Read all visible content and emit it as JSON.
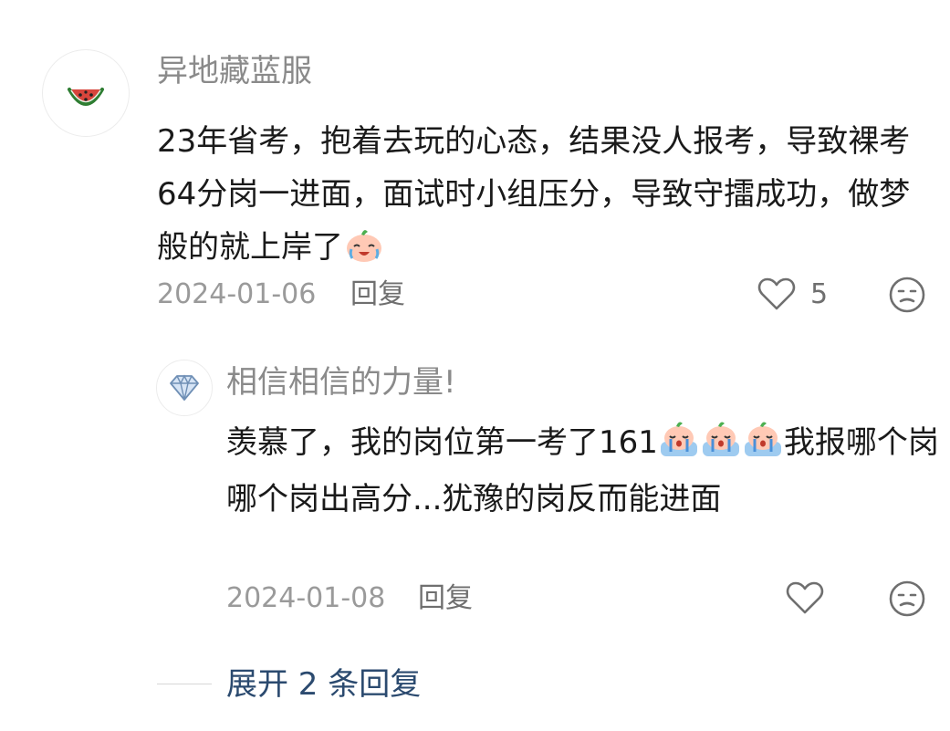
{
  "comment": {
    "username": "异地藏蓝服",
    "avatar_icon": "watermelon-icon",
    "text": "23年省考，抱着去玩的心态，结果没人报考，导致裸考64分岗一进面，面试时小组压分，导致守擂成功，做梦般的就上岸了",
    "emoji": "crying-laughing-peach-emoji",
    "date": "2024-01-06",
    "reply_label": "回复",
    "like_count": "5",
    "like_icon": "heart-outline-icon",
    "dislike_icon": "meh-face-icon"
  },
  "reply": {
    "username": "相信相信的力量!",
    "avatar_icon": "diamond-icon",
    "text_part1": "羡慕了，我的岗位第一考了161",
    "emojis": [
      "crying-peach-emoji",
      "crying-peach-emoji",
      "crying-peach-emoji"
    ],
    "text_part2": "我报哪个岗哪个岗出高分...犹豫的岗反而能进面",
    "date": "2024-01-08",
    "reply_label": "回复",
    "like_icon": "heart-outline-icon",
    "dislike_icon": "meh-face-icon"
  },
  "expand": {
    "label": "展开 2 条回复"
  },
  "colors": {
    "username": "#8a8a8a",
    "meta": "#9a9a9a",
    "link": "#2b4a6f",
    "text": "#1a1a1a"
  }
}
